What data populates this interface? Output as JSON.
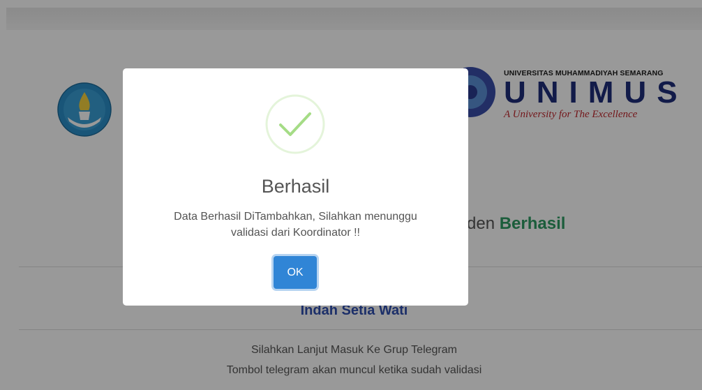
{
  "background": {
    "logos": {
      "right": {
        "university_line": "UNIVERSITAS MUHAMMADIYAH SEMARANG",
        "acronym": "UNIMUS",
        "tagline": "A University for The Excellence"
      }
    },
    "heading_partial": "den",
    "heading_status": "Berhasil",
    "name": "Indah Setia Wati",
    "info_line_1": "Silahkan Lanjut Masuk Ke Grup Telegram",
    "info_line_2": "Tombol telegram akan muncul ketika sudah validasi"
  },
  "modal": {
    "icon": "check-icon",
    "title": "Berhasil",
    "message": "Data Berhasil DiTambahkan, Silahkan menunggu validasi dari Koordinator !!",
    "ok_label": "OK"
  },
  "colors": {
    "accent": "#3085d6",
    "success": "#a5dc86",
    "status_green": "#2e9b63",
    "name_blue": "#2f4fb0"
  }
}
